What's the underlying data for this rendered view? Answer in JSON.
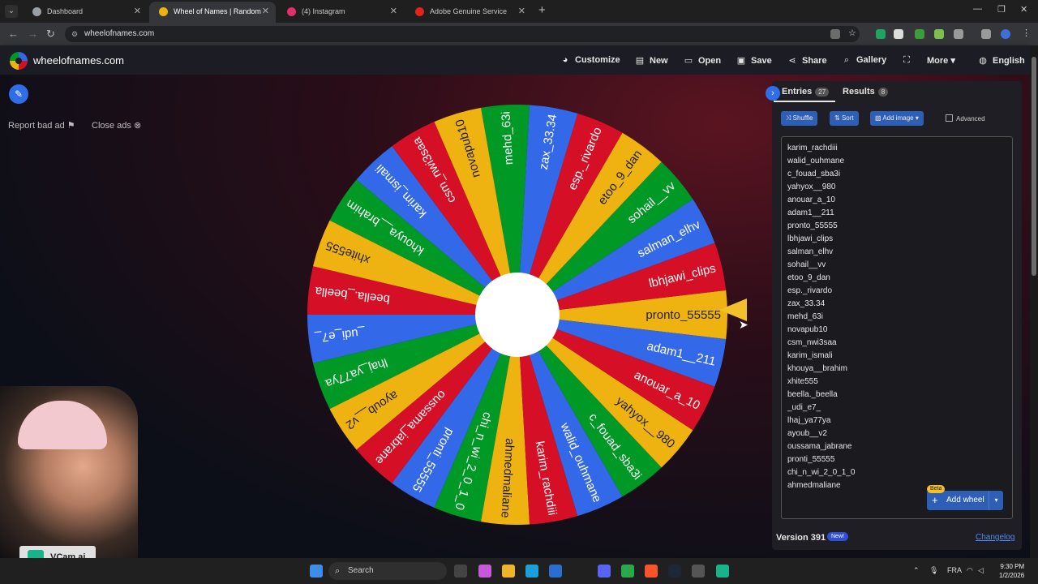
{
  "browser": {
    "tabs": [
      {
        "title": "Dashboard",
        "favicon_color": "#9aa0a6"
      },
      {
        "title": "Wheel of Names | Random",
        "favicon_color": "#eeb211"
      },
      {
        "title": "(4) Instagram",
        "favicon_color": "#e1306c"
      },
      {
        "title": "Adobe Genuine Service",
        "favicon_color": "#e0231b"
      }
    ],
    "url": "wheelofnames.com"
  },
  "header": {
    "brand": "wheelofnames.com",
    "menu": [
      {
        "label": "Customize",
        "icon": "palette-icon"
      },
      {
        "label": "New",
        "icon": "file-icon"
      },
      {
        "label": "Open",
        "icon": "folder-icon"
      },
      {
        "label": "Save",
        "icon": "save-icon"
      },
      {
        "label": "Share",
        "icon": "share-icon"
      },
      {
        "label": "Gallery",
        "icon": "search-icon"
      },
      {
        "label": "More",
        "icon": "chevron-down-icon"
      },
      {
        "label": "English",
        "icon": "globe-icon"
      }
    ]
  },
  "left": {
    "report_bad_ad": "Report bad ad",
    "close_ads": "Close ads"
  },
  "wheel": {
    "colors": [
      "#eeb211",
      "#d50f25",
      "#3369e8",
      "#009925"
    ],
    "segments": [
      "pronto_55555",
      "lbhjawi_clips",
      "salman_elhv",
      "sohail__vv",
      "etoo_9_dan",
      "esp._rivardo",
      "zax_33.34",
      "mehd_63i",
      "novapub10",
      "csm_nwi3saa",
      "karim_ismali",
      "khouya__brahim",
      "xhite555",
      "beella._beella",
      "_udi_e7_",
      "lhaj_ya77ya",
      "ayoub__v2",
      "oussama_jabrane",
      "pronti_55555",
      "chi_n_wi_2_0_1_0",
      "ahmedmaliane",
      "karim_rachdiii",
      "walid_ouhmane",
      "c_fouad_sba3i",
      "yahyox__980",
      "anouar_a_10",
      "adam1__211"
    ]
  },
  "panel": {
    "entries_label": "Entries",
    "entries_count": "27",
    "results_label": "Results",
    "results_count": "8",
    "shuffle": "Shuffle",
    "sort": "Sort",
    "add_image": "Add image",
    "advanced": "Advanced",
    "entries": [
      "karim_rachdiii",
      "walid_ouhmane",
      "c_fouad_sba3i",
      "yahyox__980",
      "anouar_a_10",
      "adam1__211",
      "pronto_55555",
      "lbhjawi_clips",
      "salman_elhv",
      "sohail__vv",
      "etoo_9_dan",
      "esp._rivardo",
      "zax_33.34",
      "mehd_63i",
      "novapub10",
      "csm_nwi3saa",
      "karim_ismali",
      "khouya__brahim",
      "xhite555",
      "beella._beella",
      "_udi_e7_",
      "lhaj_ya77ya",
      "ayoub__v2",
      "oussama_jabrane",
      "pronti_55555",
      "chi_n_wi_2_0_1_0",
      "ahmedmaliane"
    ],
    "beta": "Beta",
    "add_wheel": "Add wheel",
    "version": "Version 391",
    "new_badge": "New!",
    "changelog": "Changelog"
  },
  "webcam": {
    "label": "VCam.ai"
  },
  "taskbar": {
    "search": "Search",
    "lang": "FRA",
    "time": "9:30 PM",
    "date": "1/2/2026"
  }
}
